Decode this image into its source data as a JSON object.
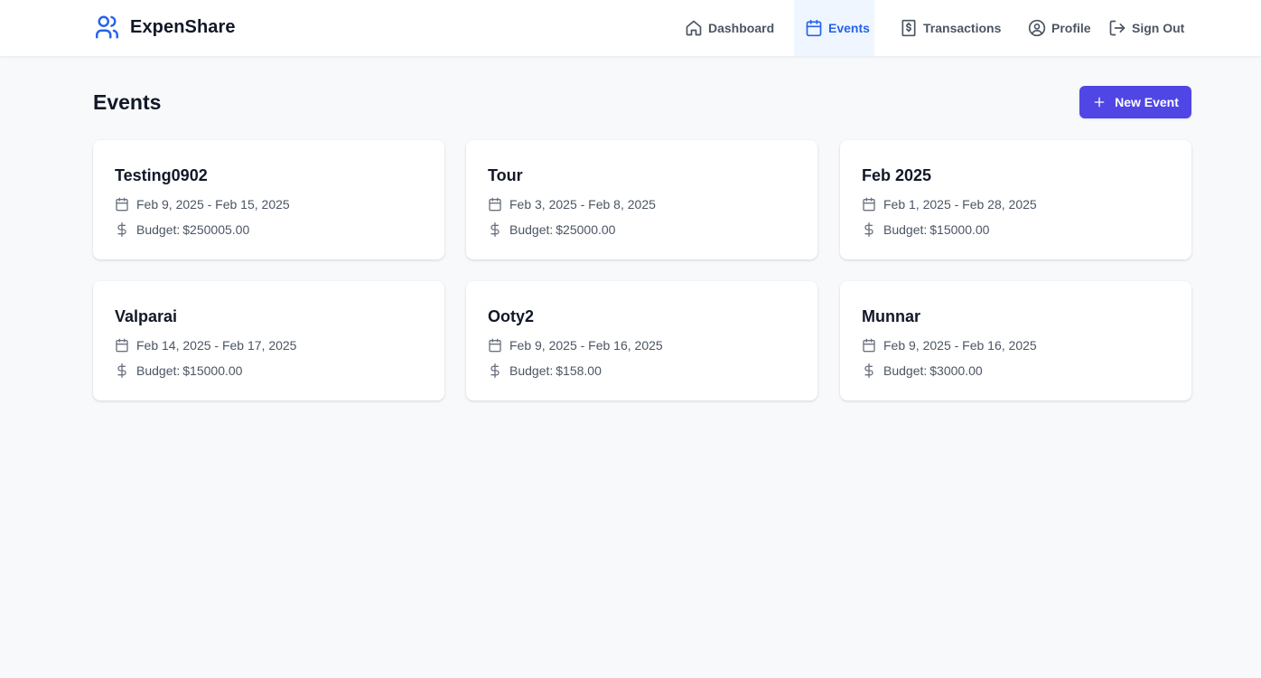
{
  "app": {
    "name": "ExpenShare"
  },
  "nav": {
    "dashboard": {
      "label": "Dashboard",
      "icon": "home-icon"
    },
    "events": {
      "label": "Events",
      "icon": "calendar-icon",
      "active": true
    },
    "transactions": {
      "label": "Transactions",
      "icon": "receipt-dollar-icon"
    },
    "profile": {
      "label": "Profile",
      "icon": "user-circle-icon"
    },
    "signout": {
      "label": "Sign Out",
      "icon": "logout-icon"
    }
  },
  "page": {
    "title": "Events",
    "new_event_label": "New Event"
  },
  "budget_prefix": "Budget:",
  "events": [
    {
      "name": "Testing0902",
      "dates": "Feb 9, 2025 - Feb 15, 2025",
      "budget": "$250005.00"
    },
    {
      "name": "Tour",
      "dates": "Feb 3, 2025 - Feb 8, 2025",
      "budget": "$25000.00"
    },
    {
      "name": "Feb 2025",
      "dates": "Feb 1, 2025 - Feb 28, 2025",
      "budget": "$15000.00"
    },
    {
      "name": "Valparai",
      "dates": "Feb 14, 2025 - Feb 17, 2025",
      "budget": "$15000.00"
    },
    {
      "name": "Ooty2",
      "dates": "Feb 9, 2025 - Feb 16, 2025",
      "budget": "$158.00"
    },
    {
      "name": "Munnar",
      "dates": "Feb 9, 2025 - Feb 16, 2025",
      "budget": "$3000.00"
    }
  ],
  "colors": {
    "accent": "#2563eb",
    "button": "#4f46e5",
    "background": "#f8f9fb",
    "text": "#111827",
    "muted": "#4b5563"
  }
}
